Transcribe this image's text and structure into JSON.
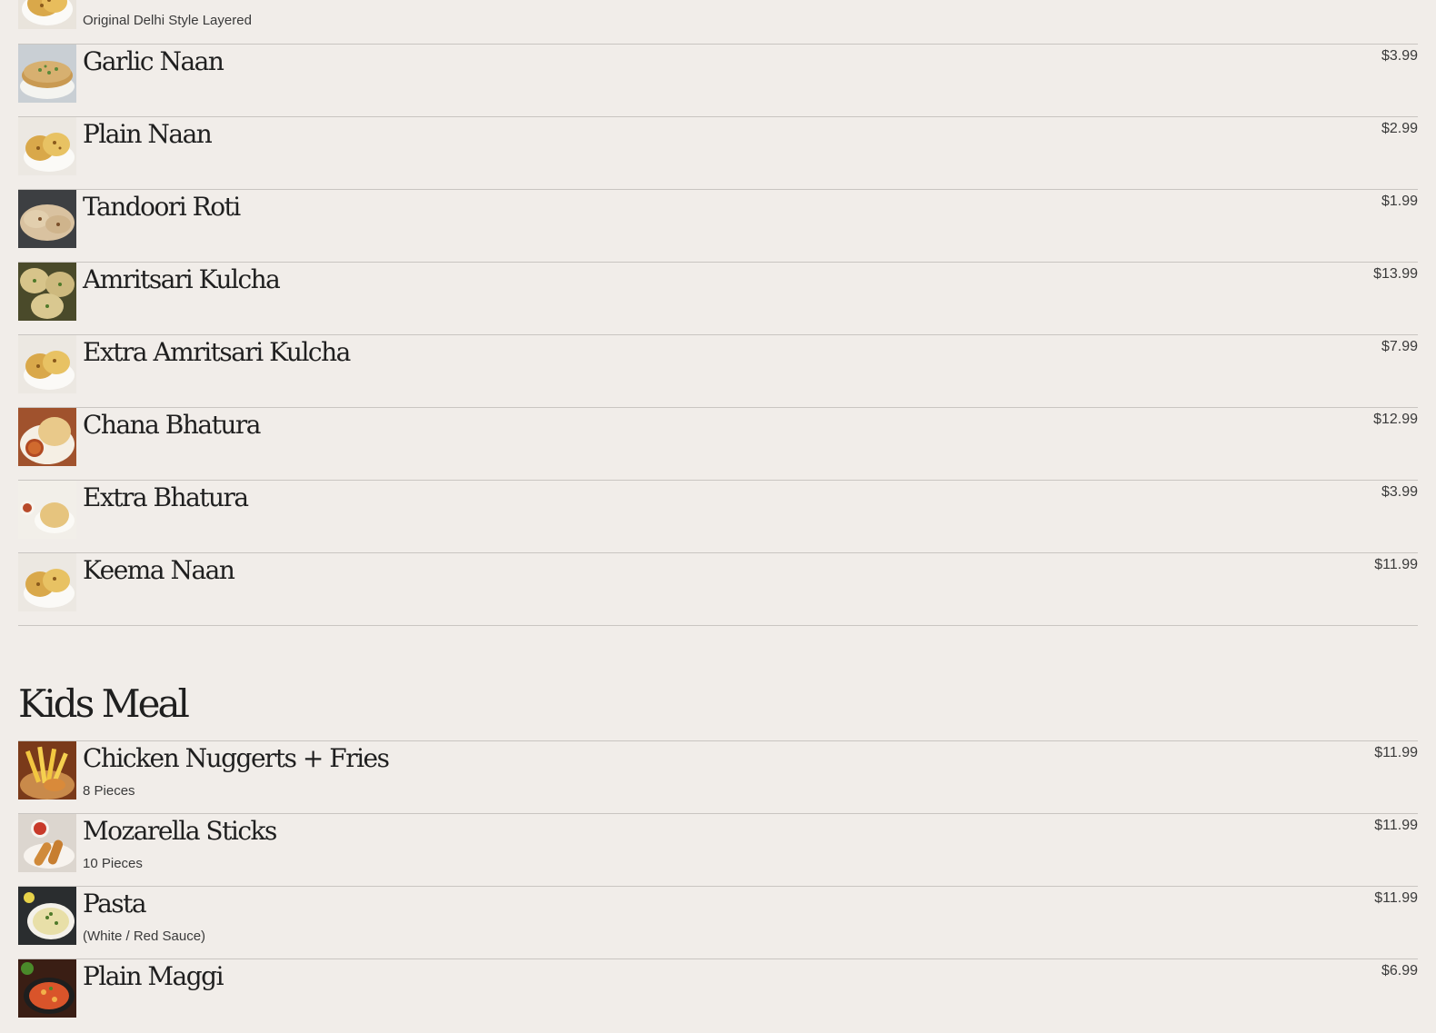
{
  "breads": {
    "items": [
      {
        "name": "",
        "desc": "Original Delhi Style Layered",
        "price": "",
        "img": "naan-icon"
      },
      {
        "name": "Garlic Naan",
        "desc": "",
        "price": "$3.99",
        "img": "garlic-naan-icon"
      },
      {
        "name": "Plain Naan",
        "desc": "",
        "price": "$2.99",
        "img": "naan-icon"
      },
      {
        "name": "Tandoori Roti",
        "desc": "",
        "price": "$1.99",
        "img": "roti-icon"
      },
      {
        "name": "Amritsari Kulcha",
        "desc": "",
        "price": "$13.99",
        "img": "kulcha-icon"
      },
      {
        "name": "Extra Amritsari Kulcha",
        "desc": "",
        "price": "$7.99",
        "img": "naan-icon"
      },
      {
        "name": "Chana Bhatura",
        "desc": "",
        "price": "$12.99",
        "img": "bhatura-icon"
      },
      {
        "name": "Extra Bhatura",
        "desc": "",
        "price": "$3.99",
        "img": "bhatura-plate-icon"
      },
      {
        "name": "Keema Naan",
        "desc": "",
        "price": "$11.99",
        "img": "naan-icon"
      }
    ]
  },
  "kids_meal": {
    "title": "Kids Meal",
    "items": [
      {
        "name": "Chicken Nuggerts + Fries",
        "desc": "8 Pieces",
        "price": "$11.99",
        "img": "fries-icon"
      },
      {
        "name": "Mozarella Sticks",
        "desc": "10 Pieces",
        "price": "$11.99",
        "img": "mozzarella-sticks-icon"
      },
      {
        "name": "Pasta",
        "desc": "(White / Red Sauce)",
        "price": "$11.99",
        "img": "pasta-icon"
      },
      {
        "name": "Plain Maggi",
        "desc": "",
        "price": "$6.99",
        "img": "maggi-icon"
      }
    ]
  },
  "colors": {
    "background": "#f1ede9",
    "rule": "#c9c5c1",
    "text": "#1f1f1f"
  }
}
